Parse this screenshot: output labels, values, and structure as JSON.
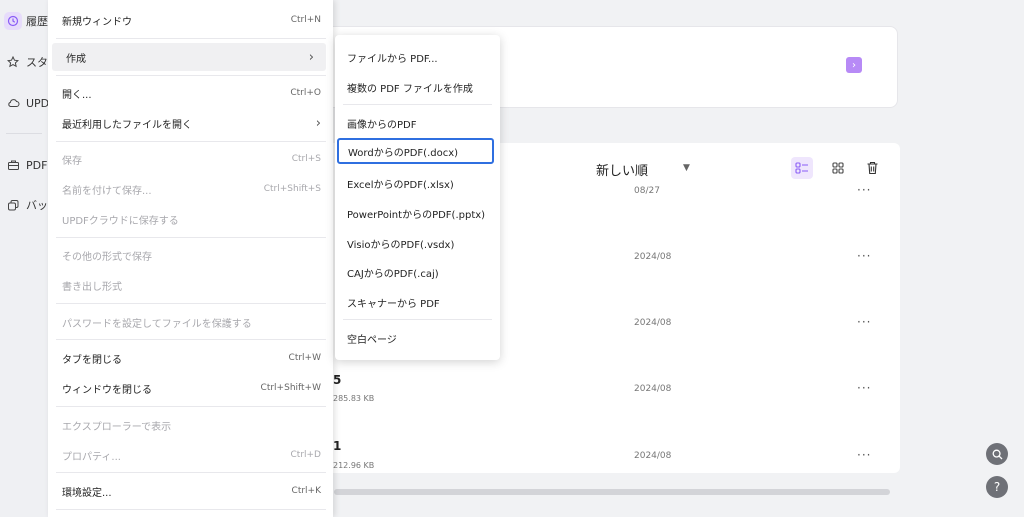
{
  "sidebar": {
    "items": [
      {
        "label": "履歴",
        "icon": "clock-icon"
      },
      {
        "label": "スター付き",
        "icon": "star-icon"
      },
      {
        "label": "UPDF",
        "icon": "cloud-icon"
      },
      {
        "label": "PDF",
        "icon": "briefcase-icon"
      },
      {
        "label": "バッチ",
        "icon": "copy-icon"
      }
    ]
  },
  "menu": {
    "items": [
      {
        "label": "新規ウィンドウ",
        "shortcut": "Ctrl+N"
      },
      {
        "label": "作成",
        "shortcut": ""
      },
      {
        "label": "開く...",
        "shortcut": "Ctrl+O"
      },
      {
        "label": "最近利用したファイルを開く",
        "shortcut": ""
      },
      {
        "label": "保存",
        "shortcut": "Ctrl+S"
      },
      {
        "label": "名前を付けて保存...",
        "shortcut": "Ctrl+Shift+S"
      },
      {
        "label": "UPDFクラウドに保存する",
        "shortcut": ""
      },
      {
        "label": "その他の形式で保存",
        "shortcut": ""
      },
      {
        "label": "書き出し形式",
        "shortcut": ""
      },
      {
        "label": "パスワードを設定してファイルを保護する",
        "shortcut": ""
      },
      {
        "label": "タブを閉じる",
        "shortcut": "Ctrl+W"
      },
      {
        "label": "ウィンドウを閉じる",
        "shortcut": "Ctrl+Shift+W"
      },
      {
        "label": "エクスプローラーで表示",
        "shortcut": ""
      },
      {
        "label": "プロパティ...",
        "shortcut": "Ctrl+D"
      },
      {
        "label": "環境設定...",
        "shortcut": "Ctrl+K"
      }
    ]
  },
  "submenu": {
    "items": [
      {
        "label": "ファイルから PDF..."
      },
      {
        "label": "複数の PDF ファイルを作成"
      },
      {
        "label": "画像からのPDF"
      },
      {
        "label": "WordからのPDF(.docx)"
      },
      {
        "label": "ExcelからのPDF(.xlsx)"
      },
      {
        "label": "PowerPointからのPDF(.pptx)"
      },
      {
        "label": "VisioからのPDF(.vsdx)"
      },
      {
        "label": "CAJからのPDF(.caj)"
      },
      {
        "label": "スキャナーから PDF"
      },
      {
        "label": "空白ページ"
      }
    ]
  },
  "main": {
    "sort_label": "新しい順",
    "rows": [
      {
        "name": "",
        "size": "",
        "date": "08/27"
      },
      {
        "name": "",
        "size": "",
        "date": "2024/08"
      },
      {
        "name": "",
        "size": "",
        "date": "2024/08"
      },
      {
        "name": "5",
        "size": "285.83 KB",
        "date": "2024/08"
      },
      {
        "name": "1",
        "size": "212.96 KB",
        "date": "2024/08"
      }
    ]
  },
  "colors": {
    "accent": "#8a5cf6",
    "selection_border": "#2f6fe0"
  }
}
